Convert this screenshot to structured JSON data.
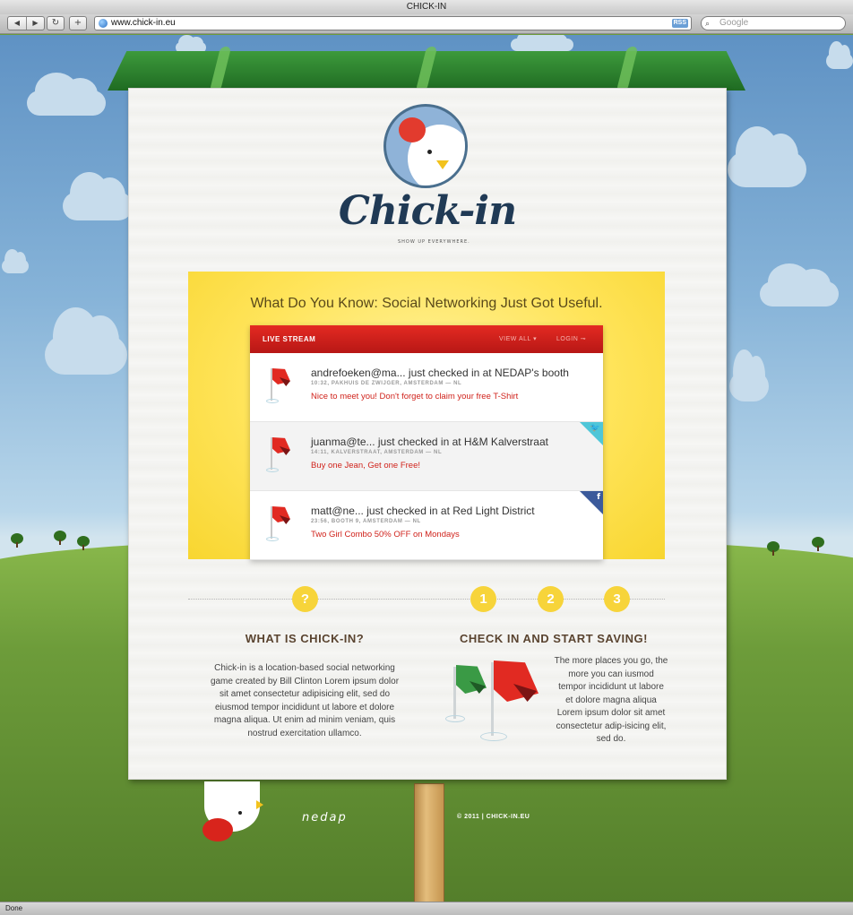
{
  "window": {
    "title": "CHICK-IN"
  },
  "toolbar": {
    "back": "◀",
    "forward": "▶",
    "reload": "↻",
    "add": "+",
    "url": "www.chick-in.eu",
    "rss": "RSS",
    "search_placeholder": "Google"
  },
  "status": "Done",
  "site": {
    "brand": "Chick-in",
    "tagline": "SHOW UP EVERYWHERE.",
    "headline": "What Do You Know: Social Networking Just Got Useful.",
    "stream": {
      "title": "LIVE STREAM",
      "view_all": "VIEW ALL ▾",
      "login": "LOGIN ⊸",
      "entries": [
        {
          "main": "andrefoeken@ma... just checked in at NEDAP's booth",
          "meta": "10:32, PAKHUIS DE ZWIJGER, AMSTERDAM — NL",
          "offer": "Nice to meet you! Don't forget to claim your free T-Shirt",
          "badge": ""
        },
        {
          "main": "juanma@te... just checked in at H&M Kalverstraat",
          "meta": "14:11, KALVERSTRAAT, AMSTERDAM — NL",
          "offer": "Buy one Jean, Get one Free!",
          "badge": "twitter-icon"
        },
        {
          "main": "matt@ne... just checked in at Red Light District",
          "meta": "23:56, BOOTH 9, AMSTERDAM — NL",
          "offer": "Two Girl Combo 50% OFF on Mondays",
          "badge": "facebook-icon"
        }
      ]
    },
    "steps": {
      "question": "?",
      "one": "1",
      "two": "2",
      "three": "3"
    },
    "what": {
      "title": "WHAT IS CHICK-IN?",
      "text": "Chick-in is a location-based social networking game created by Bill Clinton Lorem ipsum dolor sit amet consectetur adipisicing elit, sed do eiusmod tempor incididunt ut labore et dolore magna aliqua. Ut enim ad minim veniam, quis nostrud exercitation ullamco."
    },
    "checkin": {
      "title": "CHECK IN AND START SAVING!",
      "text": "The more places you go, the more you can iusmod tempor incididunt ut labore et dolore magna aliqua  Lorem ipsum dolor sit amet consectetur adip-isicing elit, sed do."
    },
    "footer": {
      "partner": "nedap",
      "copyright": "© 2011 | CHICK-IN.EU"
    }
  },
  "colors": {
    "accent_red": "#d0231c",
    "panel_yellow": "#ffe45a",
    "roof_green": "#2e8a30",
    "sky": "#86b3d8"
  }
}
